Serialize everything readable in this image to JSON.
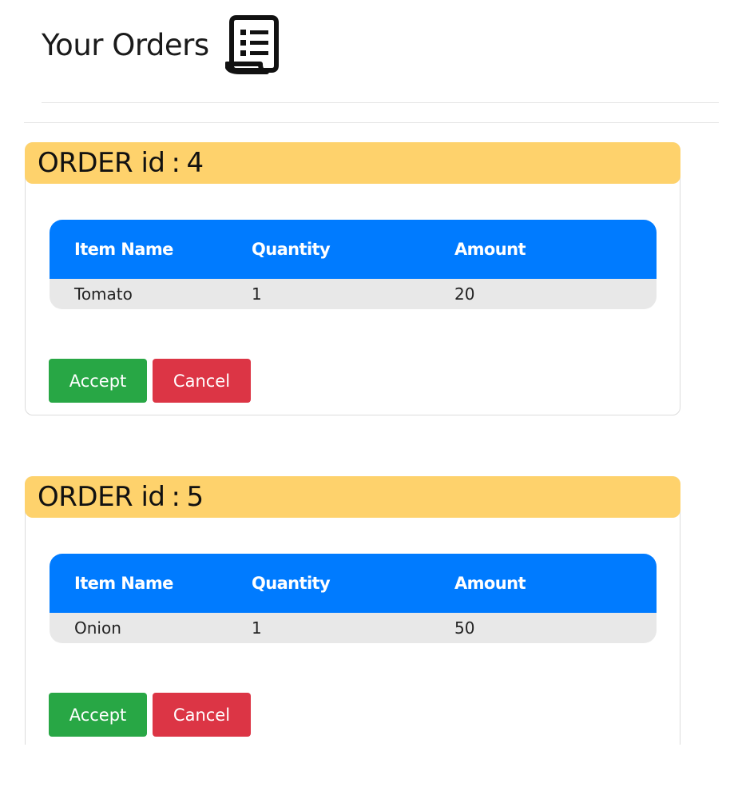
{
  "header": {
    "title": "Your Orders",
    "icon": "receipt-list-icon"
  },
  "table_columns": [
    "Item Name",
    "Quantity",
    "Amount"
  ],
  "orders": [
    {
      "label": "ORDER id",
      "id": "4",
      "items": [
        {
          "name": "Tomato",
          "quantity": "1",
          "amount": "20"
        }
      ],
      "accept_label": "Accept",
      "cancel_label": "Cancel"
    },
    {
      "label": "ORDER id",
      "id": "5",
      "items": [
        {
          "name": "Onion",
          "quantity": "1",
          "amount": "50"
        }
      ],
      "accept_label": "Accept",
      "cancel_label": "Cancel"
    }
  ],
  "colors": {
    "order_header": "#fed26c",
    "table_header": "#007bff",
    "accept": "#28a745",
    "cancel": "#dc3545",
    "row": "#e8e8e8"
  }
}
